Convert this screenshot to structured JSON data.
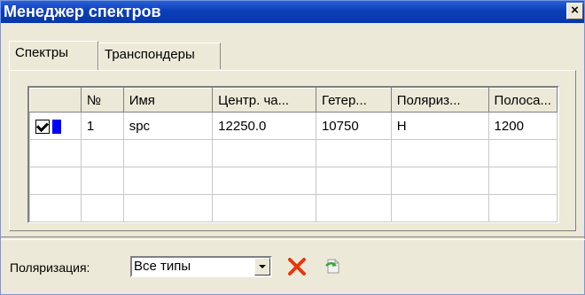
{
  "window": {
    "title": "Менеджер спектров",
    "close_symbol": "×"
  },
  "tabs": [
    {
      "label": "Спектры",
      "active": true
    },
    {
      "label": "Транспондеры",
      "active": false
    }
  ],
  "table": {
    "headers": [
      "",
      "№",
      "Имя",
      "Центр. ча...",
      "Гетер...",
      "Поляриз...",
      "Полоса..."
    ],
    "rows": [
      {
        "checked": true,
        "color": "#0000ff",
        "num": "1",
        "name": "spc",
        "center": "12250.0",
        "lo": "10750",
        "polarization": "H",
        "bandwidth": "1200"
      }
    ]
  },
  "footer": {
    "polarization_label": "Поляризация:",
    "polarization_value": "Все типы",
    "icons": [
      "delete-icon",
      "refresh-icon"
    ]
  },
  "colors": {
    "accent": "#0a3fb8",
    "swatch": "#0000ff",
    "delete": "#e8360c"
  }
}
